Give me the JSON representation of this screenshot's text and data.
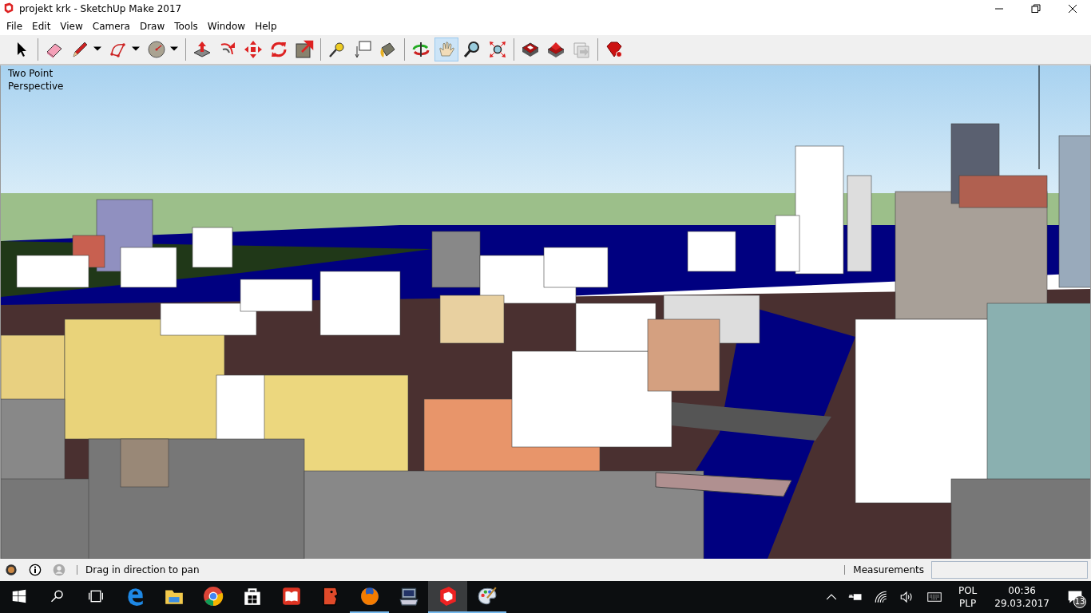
{
  "window": {
    "title": "projekt krk - SketchUp Make 2017"
  },
  "menu": [
    "File",
    "Edit",
    "View",
    "Camera",
    "Draw",
    "Tools",
    "Window",
    "Help"
  ],
  "toolbar": [
    [
      {
        "kind": "select",
        "selected": false,
        "dropdown": false
      }
    ],
    [
      {
        "kind": "eraser",
        "selected": false,
        "dropdown": false
      },
      {
        "kind": "pencil",
        "selected": false,
        "dropdown": true
      },
      {
        "kind": "arc",
        "selected": false,
        "dropdown": true
      },
      {
        "kind": "circle",
        "selected": false,
        "dropdown": true
      }
    ],
    [
      {
        "kind": "pushpull",
        "selected": false,
        "dropdown": false
      },
      {
        "kind": "offset",
        "selected": false,
        "dropdown": false
      },
      {
        "kind": "move",
        "selected": false,
        "dropdown": false
      },
      {
        "kind": "rotate",
        "selected": false,
        "dropdown": false
      },
      {
        "kind": "scale",
        "selected": false,
        "dropdown": false
      }
    ],
    [
      {
        "kind": "tape",
        "selected": false,
        "dropdown": false
      },
      {
        "kind": "text",
        "selected": false,
        "dropdown": false
      },
      {
        "kind": "paint",
        "selected": false,
        "dropdown": false
      }
    ],
    [
      {
        "kind": "orbit",
        "selected": false,
        "dropdown": false
      },
      {
        "kind": "pan",
        "selected": true,
        "dropdown": false
      },
      {
        "kind": "zoom",
        "selected": false,
        "dropdown": false
      },
      {
        "kind": "extents",
        "selected": false,
        "dropdown": false
      }
    ],
    [
      {
        "kind": "warehouse",
        "selected": false,
        "dropdown": false
      },
      {
        "kind": "share",
        "selected": false,
        "dropdown": false
      },
      {
        "kind": "layout",
        "selected": false,
        "dropdown": false
      }
    ],
    [
      {
        "kind": "ruby",
        "selected": false,
        "dropdown": false
      }
    ]
  ],
  "viewport": {
    "camera_label": "Two Point\nPerspective"
  },
  "status_bar": {
    "hint": "Drag in direction to pan",
    "measurements_label": "Measurements"
  },
  "taskbar": {
    "apps": [
      {
        "kind": "edge",
        "running": false,
        "active": false
      },
      {
        "kind": "explorer",
        "running": false,
        "active": false
      },
      {
        "kind": "chrome",
        "running": false,
        "active": false
      },
      {
        "kind": "store",
        "running": false,
        "active": false
      },
      {
        "kind": "reader",
        "running": false,
        "active": false
      },
      {
        "kind": "face",
        "running": false,
        "active": false
      },
      {
        "kind": "firefox",
        "running": true,
        "active": false
      },
      {
        "kind": "computer",
        "running": false,
        "active": false
      },
      {
        "kind": "sketchup",
        "running": true,
        "active": true
      },
      {
        "kind": "palette",
        "running": true,
        "active": false
      }
    ],
    "input_language": "POL",
    "keyboard_layout": "PLP",
    "time": "00:36",
    "date": "29.03.2017",
    "notifications": "13"
  }
}
